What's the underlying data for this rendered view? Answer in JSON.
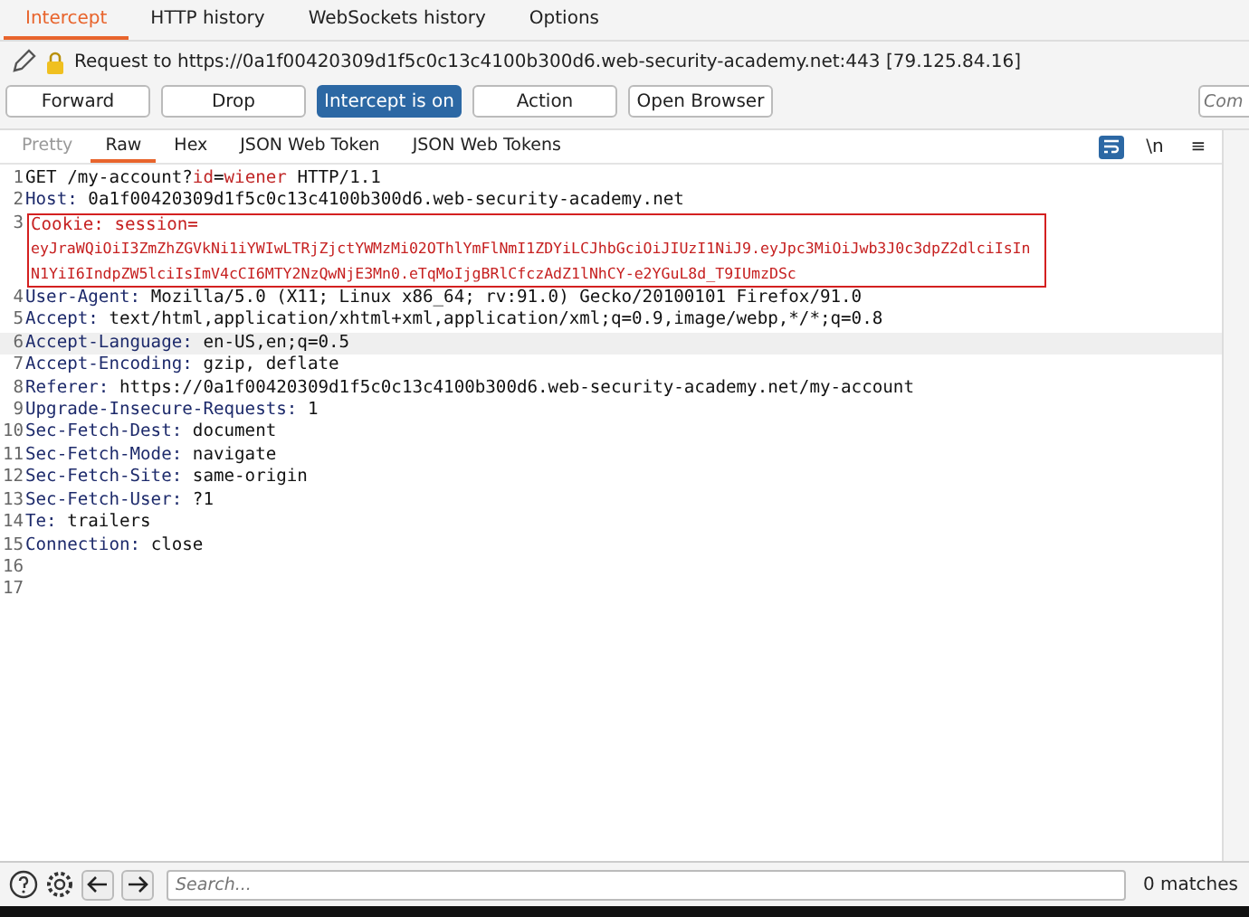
{
  "tabs": [
    {
      "label": "Intercept",
      "selected": true
    },
    {
      "label": "HTTP history",
      "selected": false
    },
    {
      "label": "WebSockets history",
      "selected": false
    },
    {
      "label": "Options",
      "selected": false
    }
  ],
  "request_info": "Request to https://0a1f00420309d1f5c0c13c4100b300d6.web-security-academy.net:443  [79.125.84.16]",
  "actions": [
    {
      "label": "Forward",
      "selected": false
    },
    {
      "label": "Drop",
      "selected": false
    },
    {
      "label": "Intercept is on",
      "selected": true
    },
    {
      "label": "Action",
      "selected": false
    },
    {
      "label": "Open Browser",
      "selected": false
    }
  ],
  "comment": {
    "placeholder": "Com"
  },
  "view_tabs": [
    {
      "label": "Pretty",
      "selected": false,
      "disabled": true
    },
    {
      "label": "Raw",
      "selected": true,
      "disabled": false
    },
    {
      "label": "Hex",
      "selected": false,
      "disabled": false
    },
    {
      "label": "JSON Web Token",
      "selected": false,
      "disabled": false
    },
    {
      "label": "JSON Web Tokens",
      "selected": false,
      "disabled": false
    }
  ],
  "editor_tools": [
    {
      "kind": "wrap",
      "selected": true
    },
    {
      "kind": "newline",
      "label": "\\n",
      "selected": false
    },
    {
      "kind": "menu",
      "label": "≡",
      "selected": false
    }
  ],
  "lines": [
    {
      "num": "1",
      "kind": "request",
      "parts": [
        {
          "kind": "plain",
          "text": "GET /my-account?"
        },
        {
          "kind": "param",
          "text": "id"
        },
        {
          "kind": "plain",
          "text": "="
        },
        {
          "kind": "param",
          "text": "wiener"
        },
        {
          "kind": "plain",
          "text": " HTTP/1.1"
        }
      ],
      "highlighted": false
    },
    {
      "num": "2",
      "kind": "header",
      "name": "Host:",
      "value": " 0a1f00420309d1f5c0c13c4100b300d6.web-security-academy.net",
      "highlighted": false
    },
    {
      "num": "3",
      "kind": "cookie",
      "name": "Cookie:",
      "value": " session=",
      "wrapped": [
        "eyJraWQiOiI3ZmZhZGVkNi1iYWIwLTRjZjctYWMzMi02OThlYmFlNmI1ZDYiLCJhbGciOiJIUzI1NiJ9.eyJpc3MiOiJwb3J0c3dpZ2dlciIsIn",
        "N1YiI6IndpZW5lciIsImV4cCI6MTY2NzQwNjE3Mn0.eTqMoIjgBRlCfczAdZ1lNhCY-e2YGuL8d_T9IUmzDSc"
      ],
      "highlighted": false
    },
    {
      "num": "4",
      "kind": "header",
      "name": "User-Agent:",
      "value": " Mozilla/5.0 (X11; Linux x86_64; rv:91.0) Gecko/20100101 Firefox/91.0",
      "highlighted": false
    },
    {
      "num": "5",
      "kind": "header",
      "name": "Accept:",
      "value": " text/html,application/xhtml+xml,application/xml;q=0.9,image/webp,*/*;q=0.8",
      "highlighted": false
    },
    {
      "num": "6",
      "kind": "header",
      "name": "Accept-Language:",
      "value": " en-US,en;q=0.5",
      "highlighted": true
    },
    {
      "num": "7",
      "kind": "header",
      "name": "Accept-Encoding:",
      "value": " gzip, deflate",
      "highlighted": false
    },
    {
      "num": "8",
      "kind": "header",
      "name": "Referer:",
      "value": " https://0a1f00420309d1f5c0c13c4100b300d6.web-security-academy.net/my-account",
      "highlighted": false
    },
    {
      "num": "9",
      "kind": "header",
      "name": "Upgrade-Insecure-Requests:",
      "value": " 1",
      "highlighted": false
    },
    {
      "num": "10",
      "kind": "header",
      "name": "Sec-Fetch-Dest:",
      "value": " document",
      "highlighted": false
    },
    {
      "num": "11",
      "kind": "header",
      "name": "Sec-Fetch-Mode:",
      "value": " navigate",
      "highlighted": false
    },
    {
      "num": "12",
      "kind": "header",
      "name": "Sec-Fetch-Site:",
      "value": " same-origin",
      "highlighted": false
    },
    {
      "num": "13",
      "kind": "header",
      "name": "Sec-Fetch-User:",
      "value": " ?1",
      "highlighted": false
    },
    {
      "num": "14",
      "kind": "header",
      "name": "Te:",
      "value": " trailers",
      "highlighted": false
    },
    {
      "num": "15",
      "kind": "header",
      "name": "Connection:",
      "value": " close",
      "highlighted": false
    },
    {
      "num": "16",
      "kind": "empty",
      "highlighted": false
    },
    {
      "num": "17",
      "kind": "empty",
      "highlighted": false
    }
  ],
  "search": {
    "placeholder": "Search..."
  },
  "matches": "0 matches"
}
